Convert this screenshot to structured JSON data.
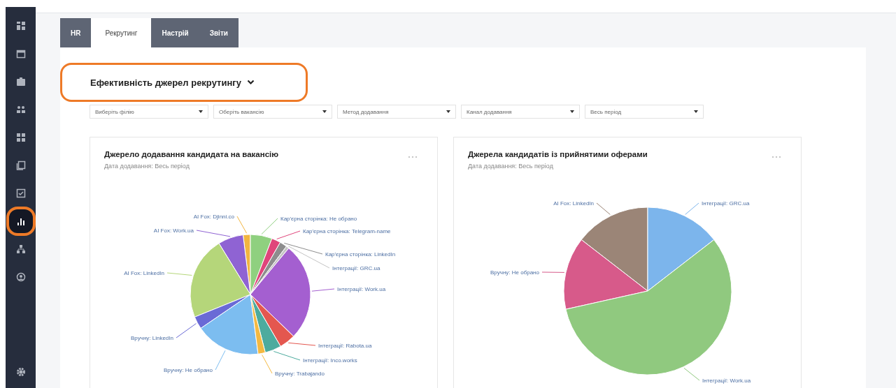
{
  "sidebar": {
    "items": [
      {
        "selected": false
      },
      {
        "selected": false
      },
      {
        "selected": false
      },
      {
        "selected": false
      },
      {
        "selected": false
      },
      {
        "selected": false
      },
      {
        "selected": false
      },
      {
        "selected": true
      },
      {
        "selected": false
      },
      {
        "selected": false
      },
      {
        "selected": false
      }
    ]
  },
  "tabs": [
    {
      "label": "HR",
      "selected": false
    },
    {
      "label": "Рекрутинг",
      "selected": true
    },
    {
      "label": "Настрій",
      "selected": false
    },
    {
      "label": "Звіти",
      "selected": false
    }
  ],
  "section_title": "Ефективність джерел рекрутингу",
  "filters": [
    {
      "placeholder": "Виберіть філію"
    },
    {
      "placeholder": "Оберіть вакансію"
    },
    {
      "placeholder": "Метод додавання"
    },
    {
      "placeholder": "Канал додавання"
    },
    {
      "placeholder": "Весь період"
    }
  ],
  "charts": [
    {
      "title": "Джерело додавання кандидата на вакансію",
      "subtitle": "Дата додавання: Весь період",
      "slices": [
        {
          "label": "AI Fox: Djinni.co",
          "color": "#f2b540"
        },
        {
          "label": "Кар'єрна сторінка: Не обрано",
          "color": "#8fd07f"
        },
        {
          "label": "AI Fox: Work.ua",
          "color": "#8f63d3"
        },
        {
          "label": "Кар'єрна сторінка: Telegram-name",
          "color": "#e0457b"
        },
        {
          "label": "Кар'єрна сторінка: LinkedIn",
          "color": "#8d8d8d"
        },
        {
          "label": "Інтеграції: GRC.ua",
          "color": "#c4c4c4"
        },
        {
          "label": "AI Fox: LinkedIn",
          "color": "#b5d67a"
        },
        {
          "label": "Інтеграції: Work.ua",
          "color": "#a45fd0"
        },
        {
          "label": "Вручну: LinkedIn",
          "color": "#6a6ad6"
        },
        {
          "label": "Інтеграції: Rabota.ua",
          "color": "#e4574f"
        },
        {
          "label": "Інтеграції: Inco.works",
          "color": "#4dab9e"
        },
        {
          "label": "Вручну: Не обрано",
          "color": "#7cbdf0"
        },
        {
          "label": "Вручну: Trabajando",
          "color": "#f4b942"
        }
      ]
    },
    {
      "title": "Джерела кандидатів із прийнятими оферами",
      "subtitle": "Дата додавання: Весь період",
      "slices": [
        {
          "label": "AI Fox: LinkedIn",
          "color": "#9b8577"
        },
        {
          "label": "Інтеграції: GRC.ua",
          "color": "#7cb5ec"
        },
        {
          "label": "Вручну: Не обрано",
          "color": "#d75a8a"
        },
        {
          "label": "Інтеграції: Work.ua",
          "color": "#90c97f"
        }
      ]
    }
  ]
}
